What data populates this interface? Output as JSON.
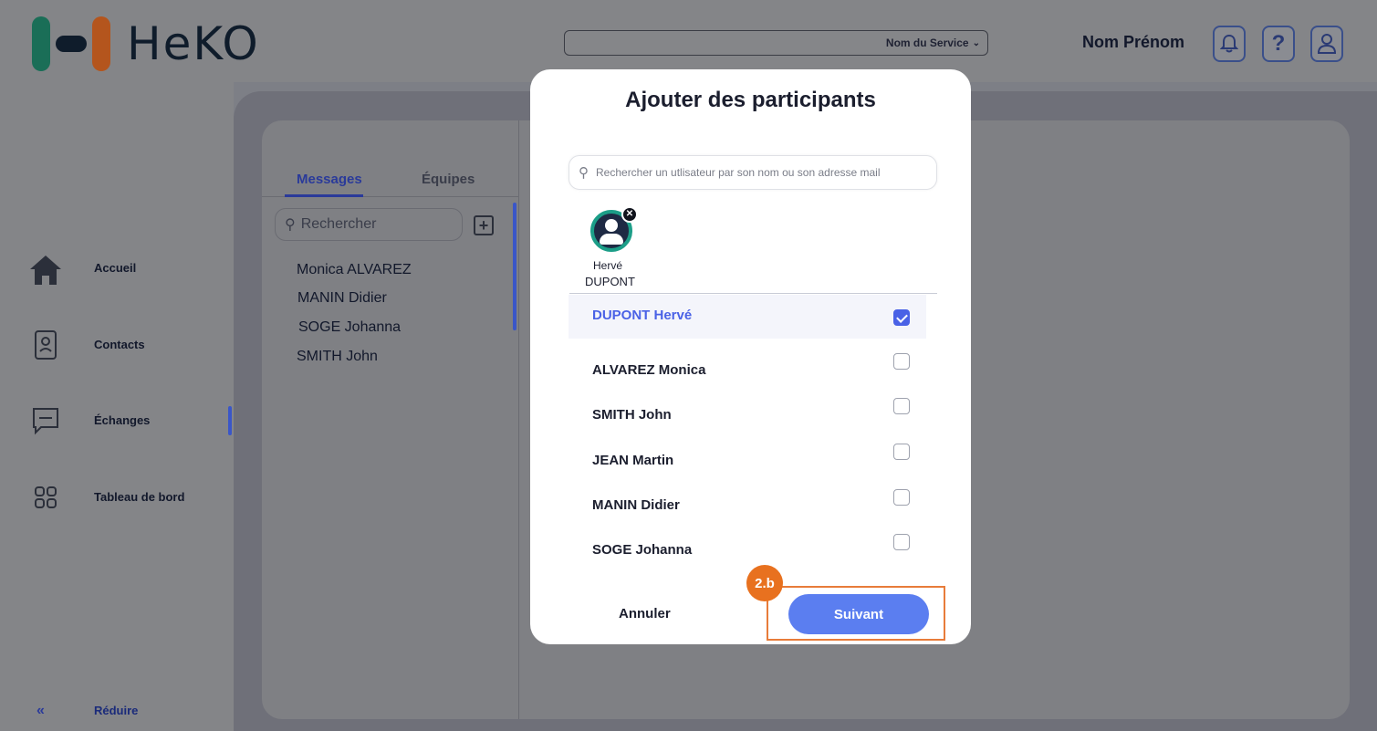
{
  "header": {
    "logo_text": "HeKO",
    "service_select": {
      "value": "Nom du Service"
    },
    "user_name": "Nom Prénom",
    "icons": [
      "bell-icon",
      "help-icon",
      "user-icon"
    ]
  },
  "sidebar": {
    "items": [
      {
        "label": "Accueil",
        "icon": "home-icon"
      },
      {
        "label": "Contacts",
        "icon": "contacts-icon"
      },
      {
        "label": "Échanges",
        "icon": "chat-icon",
        "active": true
      },
      {
        "label": "Tableau de bord",
        "icon": "dashboard-icon"
      }
    ],
    "reduce_label": "Réduire",
    "reduce_icon": "«"
  },
  "conversations": {
    "tabs": [
      {
        "label": "Messages",
        "active": true
      },
      {
        "label": "Équipes",
        "active": false
      }
    ],
    "search_placeholder": "Rechercher",
    "items": [
      "Monica ALVAREZ",
      "MANIN Didier",
      "SOGE Johanna",
      "SMITH John"
    ]
  },
  "modal": {
    "title": "Ajouter des participants",
    "search_placeholder": "Rechercher un utlisateur par son nom ou son adresse mail",
    "selected_chip": {
      "first": "Hervé",
      "last": "DUPONT"
    },
    "users": [
      {
        "name": "DUPONT Hervé",
        "checked": true
      },
      {
        "name": "ALVAREZ Monica",
        "checked": false
      },
      {
        "name": "SMITH John",
        "checked": false
      },
      {
        "name": "JEAN Martin",
        "checked": false
      },
      {
        "name": "MANIN Didier",
        "checked": false
      },
      {
        "name": "SOGE Johanna",
        "checked": false
      }
    ],
    "cancel_label": "Annuler",
    "next_label": "Suivant",
    "step_badge": "2.b"
  },
  "colors": {
    "accent": "#4a62e6",
    "primary_button": "#5b7ef0",
    "highlight": "#e87c3a",
    "badge": "#e8711f",
    "overlay": "#7d7f86"
  }
}
